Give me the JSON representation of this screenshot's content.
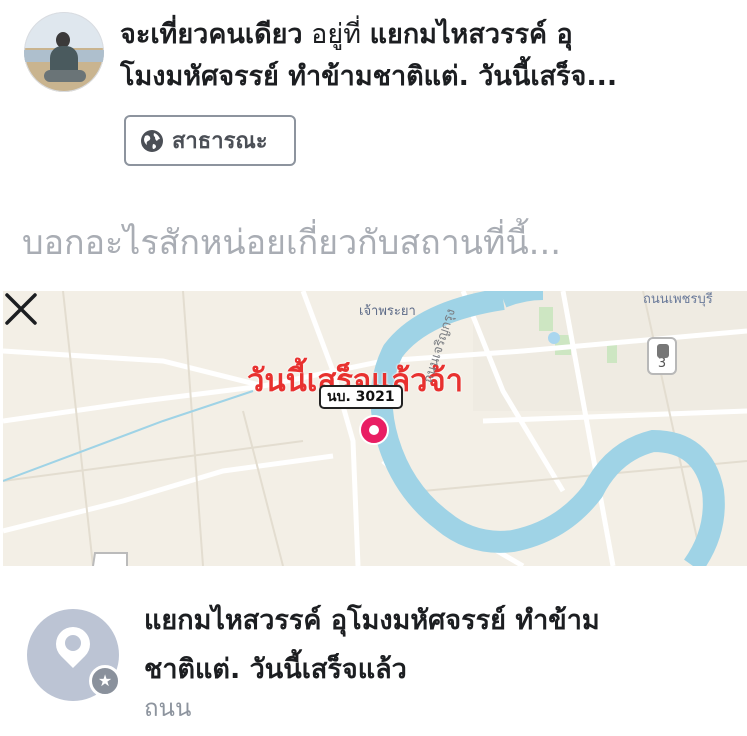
{
  "post": {
    "title_bold": "จะเที่ยวคนเดียว",
    "title_at": " อยู่ที่ ",
    "title_line1_place": "แยกมไหสวรรค์ อุ",
    "title_line2": "โมงมหัศจรรย์ ทำข้ามชาติแต่. วันนี้เสร็จ...",
    "privacy_label": "สาธารณะ",
    "caption_placeholder": "บอกอะไรสักหน่อยเกี่ยวกับสถานที่นี้..."
  },
  "map": {
    "overlay_text": "วันนี้เสร็จแล้วจ้า",
    "road_label": "นบ. 3021",
    "district_label": "เจ้าพระยา",
    "street_label": "ถนนเจริญกรุง",
    "top_right_label": "ถนนเพชรบุรี",
    "route_shield_number": "3"
  },
  "place": {
    "name_line1": "แยกมไหสวรรค์ อุโมงมหัศจรรย์ ทำข้าม",
    "name_line2": "ชาติแต่. วันนี้เสร็จแล้ว",
    "category": "ถนน"
  },
  "icons": {
    "privacy": "globe-icon",
    "close": "close-icon",
    "place": "map-pin-icon",
    "badge": "star-icon"
  },
  "colors": {
    "pin": "#e91e63",
    "overlay_text": "#e8312f",
    "river": "#9fd3e6"
  }
}
